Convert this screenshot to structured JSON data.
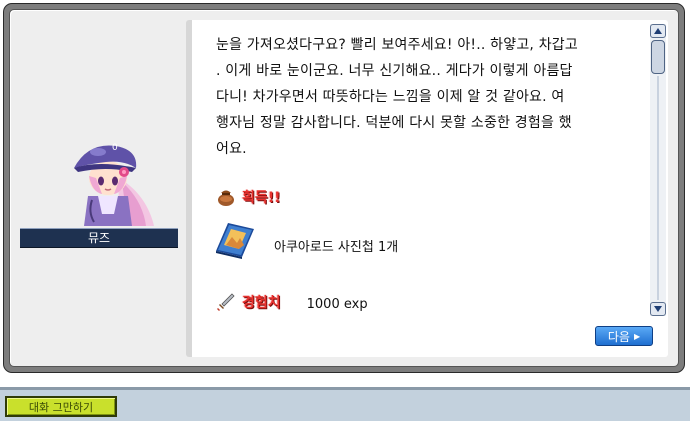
{
  "npc": {
    "name": "뮤즈"
  },
  "dialog": {
    "lines": [
      "눈을 가져오셨다구요? 빨리 보여주세요! 아!.. 하얗고, 차갑고",
      ". 이게 바로 눈이군요. 너무 신기해요.. 게다가 이렇게 아름답",
      "다니! 차가우면서 따뜻하다는 느낌을 이제 알 것 같아요. 여",
      "행자님 정말 감사합니다. 덕분에 다시 못할 소중한 경험을 했",
      "어요."
    ]
  },
  "reward": {
    "header_label": "획득!!",
    "item_label": "아쿠아로드 사진첩 1개",
    "exp_label": "경험치",
    "exp_value": "1000 exp"
  },
  "buttons": {
    "next_label": "다음",
    "end_chat_label": "대화 그만하기"
  },
  "colors": {
    "frame": "#7d7d7d",
    "panel": "#eeeeee",
    "nameplate": "#1e3150",
    "reward_text": "#e8322f",
    "next_button": "#2f86e0",
    "end_chat_button": "#c9e02c",
    "bottom_bar": "#c3d1dd"
  },
  "icons": {
    "reward_bag": "bag-icon",
    "photo_album": "photo-album-icon",
    "exp": "sword-icon",
    "scroll_up": "scroll-up-arrow-icon",
    "scroll_down": "scroll-down-arrow-icon",
    "next_arrow": "triangle-right-icon"
  }
}
